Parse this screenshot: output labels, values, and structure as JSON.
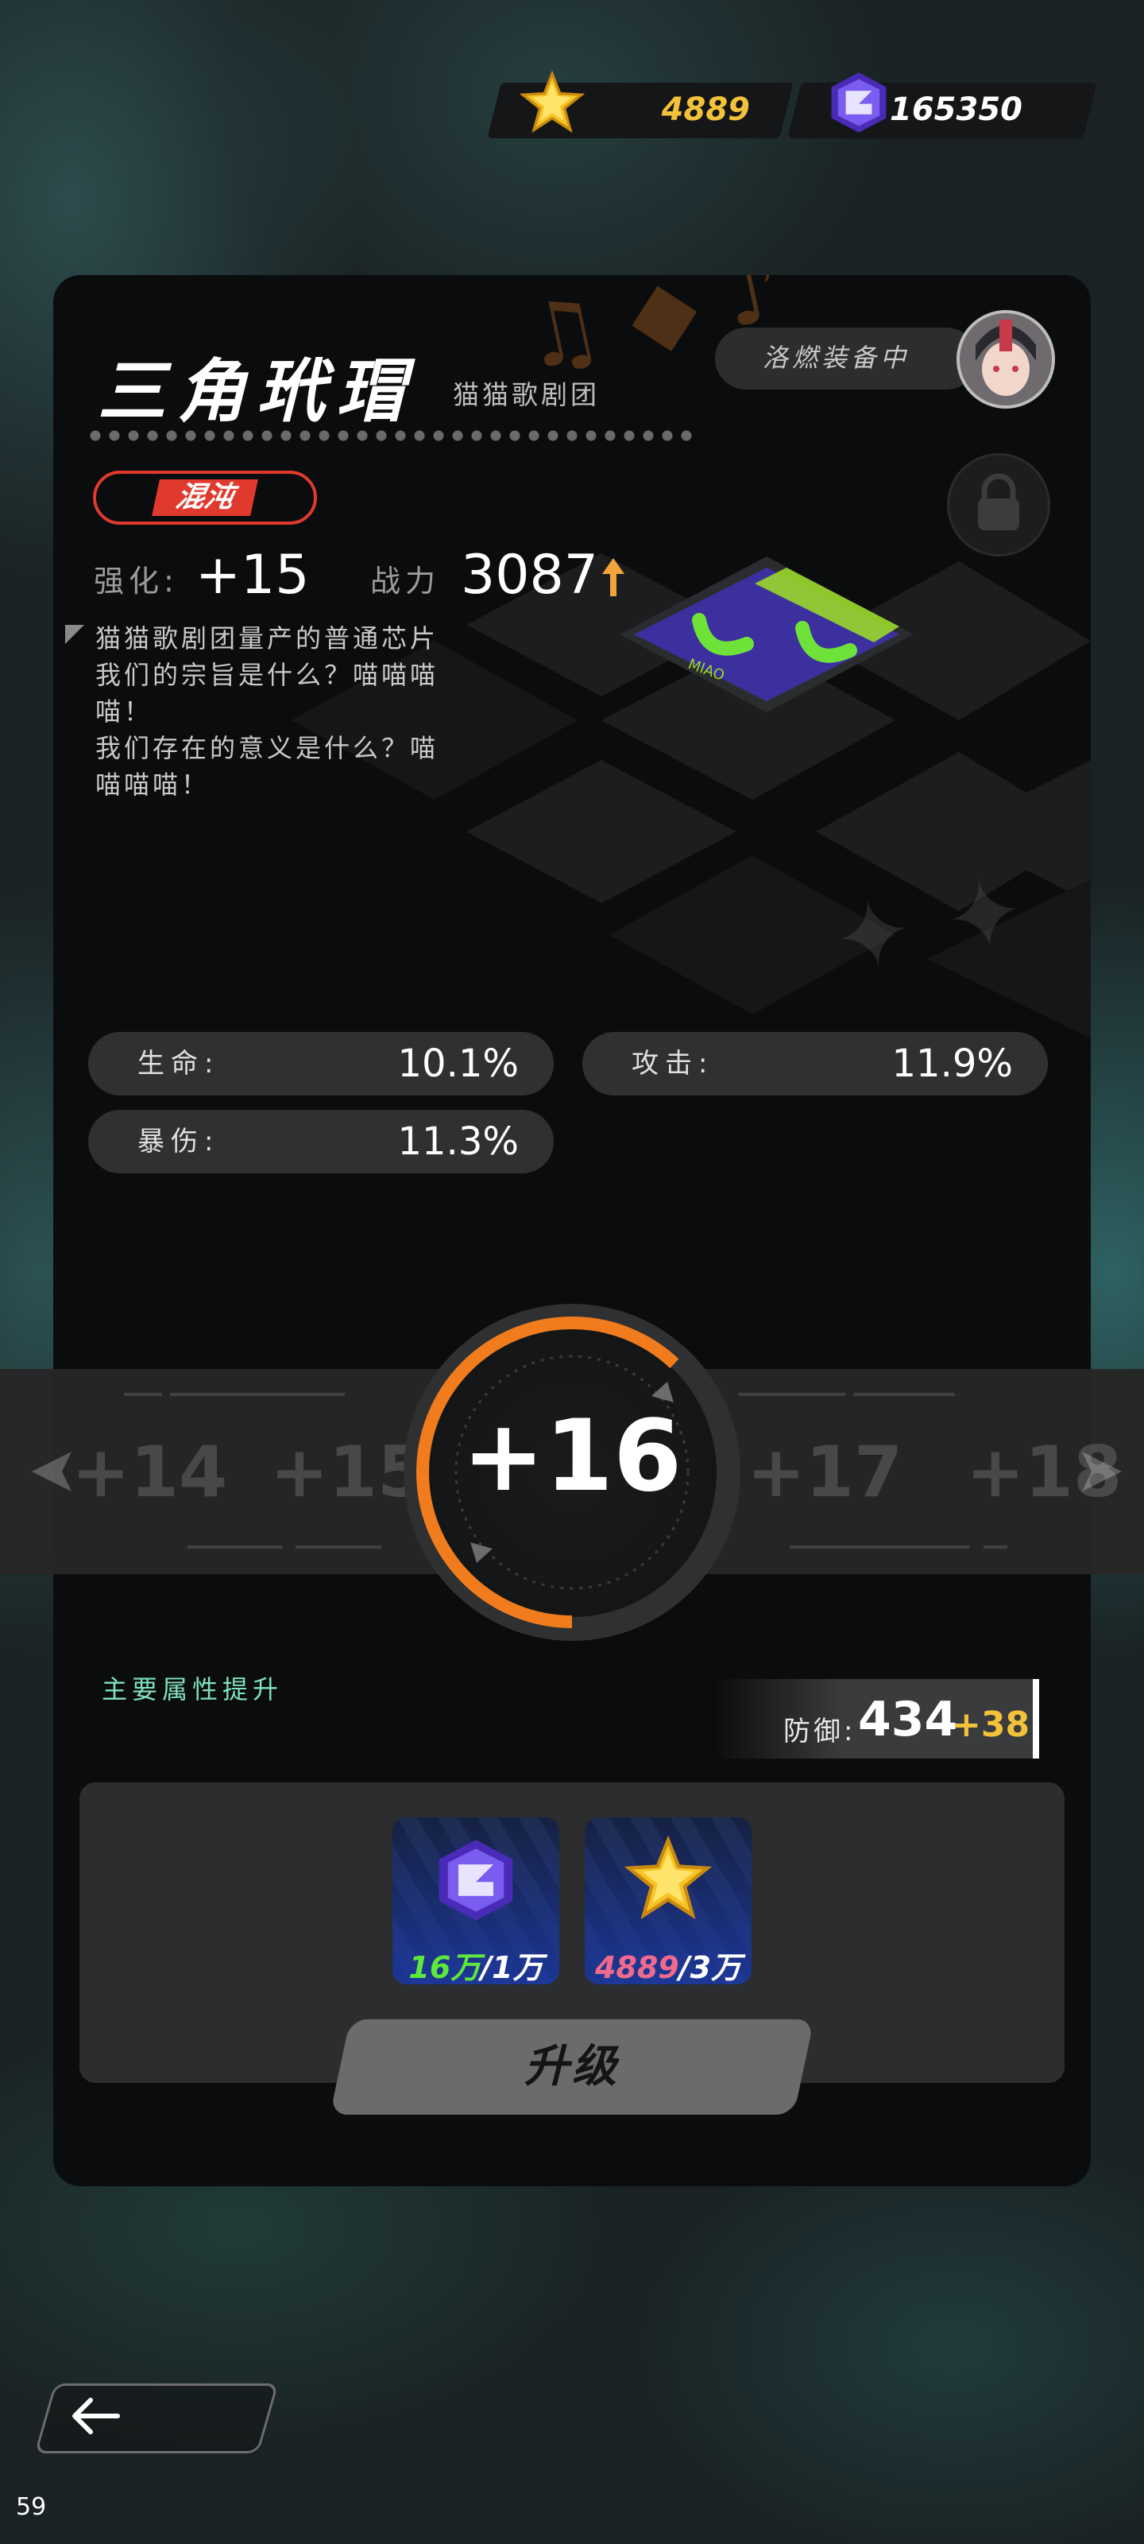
{
  "currency": {
    "gold_amount": "4889",
    "gem_amount": "165350",
    "gold_icon": "star-icon",
    "gem_icon": "purple-cube-icon"
  },
  "item": {
    "name": "三角玳瑁",
    "series": "猫猫歌剧团",
    "equipped_by": "洛燃装备中",
    "rarity": "混沌",
    "enhance_label": "强化:",
    "enhance_value": "+15",
    "power_label": "战力",
    "power_value": "3087",
    "description": [
      "猫猫歌剧团量产的普通芯片",
      "我们的宗旨是什么？喵喵喵",
      "喵！",
      "我们存在的意义是什么？喵",
      "喵喵喵！"
    ]
  },
  "attributes": [
    {
      "label": "生命:",
      "value": "10.1%"
    },
    {
      "label": "攻击:",
      "value": "11.9%"
    },
    {
      "label": "暴伤:",
      "value": "11.3%"
    }
  ],
  "level_selector": {
    "levels": [
      "+14",
      "+15",
      "+16",
      "+17",
      "+18"
    ],
    "current": "+16",
    "progress": 0.62
  },
  "upgrade": {
    "main_attr_title": "主要属性提升",
    "defense_label": "防御:",
    "defense_value": "434",
    "defense_bonus": "+38",
    "costs": [
      {
        "icon": "purple-cube-icon",
        "have": "16万",
        "need": "/1万"
      },
      {
        "icon": "star-icon",
        "have": "4889",
        "need": "/3万"
      }
    ],
    "button_label": "升级"
  },
  "footer": {
    "back_icon": "arrow-left-icon",
    "fps": "59"
  },
  "colors": {
    "gold": "#f2c23a",
    "rarity_red": "#e03a2e",
    "accent_orange": "#f07c1e",
    "mint": "#7fe3c1",
    "have_green": "#5ee83c",
    "have_pink": "#f06a8e"
  }
}
